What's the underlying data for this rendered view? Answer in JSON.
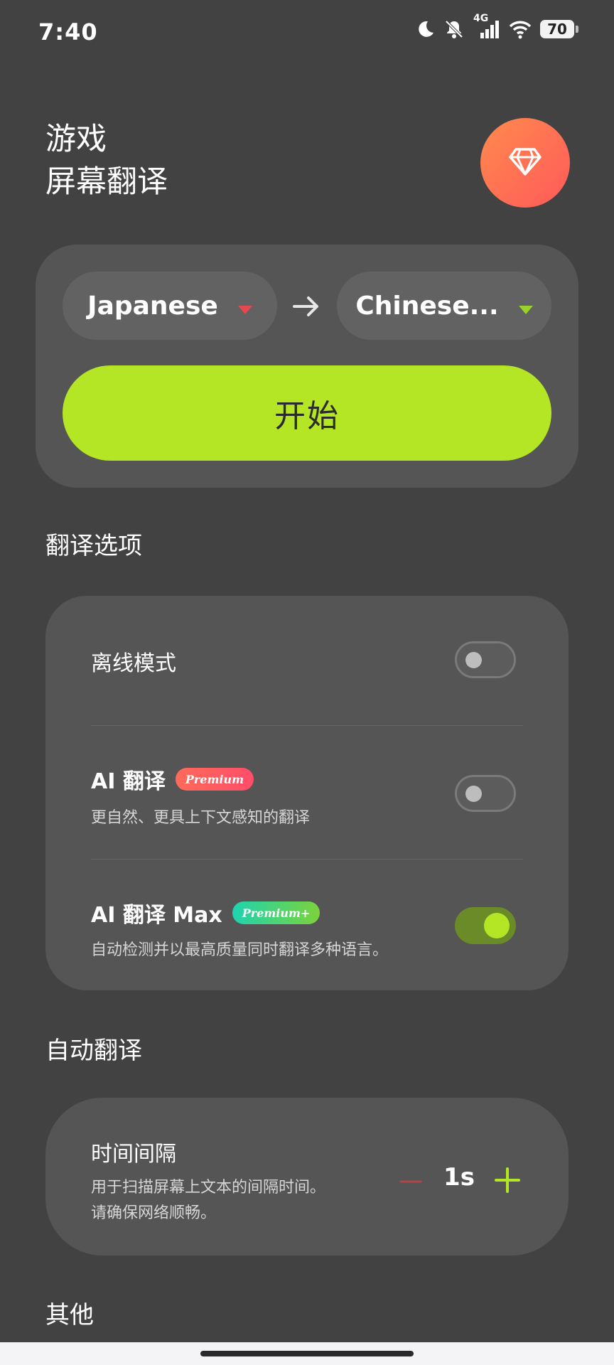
{
  "status_bar": {
    "time": "7:40",
    "network": "4G",
    "battery": "70"
  },
  "header": {
    "title_line1": "游戏",
    "title_line2": "屏幕翻译",
    "premium_icon": "gem-icon"
  },
  "language": {
    "source": "Japanese",
    "target": "Chinese...",
    "source_caret_color": "#e5484d",
    "target_caret_color": "#9bd12a"
  },
  "start_button": {
    "label": "开始",
    "color": "#b4e625"
  },
  "sections": {
    "translation_options": "翻译选项",
    "auto_translate": "自动翻译",
    "others": "其他"
  },
  "options": [
    {
      "label": "离线模式",
      "enabled": false
    },
    {
      "label": "AI 翻译",
      "badge": "Premium",
      "description": "更自然、更具上下文感知的翻译",
      "enabled": false
    },
    {
      "label": "AI 翻译 Max",
      "badge": "Premium+",
      "description": "自动检测并以最高质量同时翻译多种语言。",
      "enabled": true
    }
  ],
  "interval": {
    "label": "时间间隔",
    "description_line1": "用于扫描屏幕上文本的间隔时间。",
    "description_line2": "请确保网络顺畅。",
    "value": "1s"
  }
}
